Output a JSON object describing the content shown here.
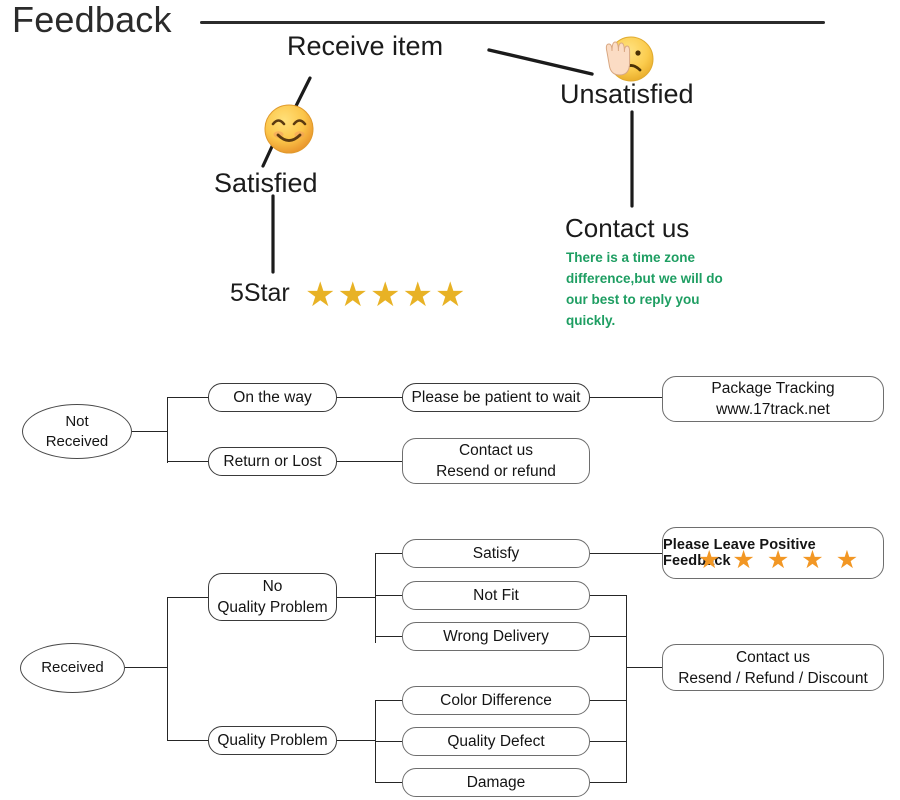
{
  "header": {
    "title": "Feedback"
  },
  "satisfaction": {
    "receive_item_label": "Receive item",
    "satisfied_label": "Satisfied",
    "unsatisfied_label": "Unsatisfied",
    "satisfied_icon": "smiling-face-emoji",
    "unsatisfied_icon": "frowning-face-with-raised-hand-emoji",
    "five_star_label": "5Star",
    "five_star_count": 5,
    "star_color": "#e8b225",
    "contact_us_title": "Contact us",
    "contact_us_note": "There is a time zone difference,but we will do our best to reply you quickly.",
    "contact_us_note_color": "#1e9e62"
  },
  "not_received_flow": {
    "root": "Not\nReceived",
    "root_line1": "Not",
    "root_line2": "Received",
    "branches": [
      {
        "label": "On the way",
        "next": "Please be patient to wait",
        "final_line1": "Package Tracking",
        "final_line2": "www.17track.net"
      },
      {
        "label": "Return or Lost",
        "next_line1": "Contact us",
        "next_line2": "Resend or refund"
      }
    ]
  },
  "received_flow": {
    "root": "Received",
    "no_quality_problem_line1": "No",
    "no_quality_problem_line2": "Quality Problem",
    "quality_problem": "Quality Problem",
    "no_quality_children": [
      "Satisfy",
      "Not Fit",
      "Wrong Delivery"
    ],
    "quality_children": [
      "Color Difference",
      "Quality Defect",
      "Damage"
    ],
    "positive_feedback": {
      "caption": "Please Leave Positive Feedback",
      "star_count": 5,
      "star_color": "#f29724"
    },
    "contact_outcome_line1": "Contact us",
    "contact_outcome_line2": "Resend / Refund / Discount"
  }
}
